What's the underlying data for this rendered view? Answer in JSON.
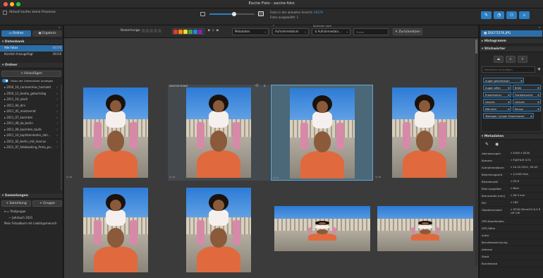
{
  "window": {
    "title": "Excire Foto - excire-foto"
  },
  "toolbar": {
    "status": "Aktuell laufen keine Prozesse",
    "zoom_value": 0.55,
    "count_line_prefix": "Fotos in der aktuellen Ansicht:",
    "count_value": "40378",
    "selected_line": "Fotos ausgewählt: 1"
  },
  "left": {
    "tabs": [
      "Ordner",
      "Ergebnis"
    ],
    "database_header": "Datenbank",
    "database_items": [
      {
        "label": "Alle Fotos",
        "count": "40378"
      },
      {
        "label": "Kürzlich hinzugefügt",
        "count": "39418"
      }
    ],
    "folders_header": "Ordner",
    "add_button": "+ Hinzufügen",
    "toggle_label": "Fotos der Unterordner anzeigen",
    "folders": [
      "2016_10_cannamirius_hochzeit",
      "2016_11_beatiu_geburtstag",
      "2011_10_ulach",
      "2011_04_dini",
      "2011_05_montserrat",
      "2011_07_kaernten",
      "2011_09_da_berlin",
      "2011_09_kaernten_taufe",
      "2011_10_kopfsteinhofen_dim...",
      "2012_02_berlin_mit_marcus",
      "2012_07_fotobooking_firma_pe..."
    ],
    "collections_header": "Sammlungen",
    "collection_button": "+ Sammlung",
    "group_button": "+ Gruppe",
    "collections": [
      "Testgruppe",
      "Jahrbuch 2021",
      "Mein Fotoalbum mit Lieblingsmensch"
    ]
  },
  "filter": {
    "rating_label": "Bewertung",
    "rating_value": "≥",
    "colors": [
      "#e53935",
      "#fb8c00",
      "#fdd835",
      "#43a047",
      "#1e88e5",
      "#8e24aa"
    ],
    "metadata_select": "Metadaten",
    "date_select": "Aufnahmedatum",
    "sort_label": "Sortieren nach",
    "sort_select": "Aufnahmedatu...",
    "search_placeholder": "Suche",
    "reset_button": "Zurücksetzen"
  },
  "grid": {
    "selected_label": "DSCF5576.RAF",
    "selected_index": 6
  },
  "right": {
    "file_name": "DSCF5576.JPG",
    "histogram_header": "Histogramm",
    "keywords_header": "Stichwörter",
    "keywords_placeholder": "Stichwörter hinzufügen",
    "keywords": [
      "Augen geschlossen",
      "Augen offen",
      "Brille",
      "Erwachsener",
      "Frontalansicht",
      "Gesicht",
      "Lächeln",
      "Männlich",
      "Person",
      "Teenager / junger Erwachsener"
    ],
    "metadata_header": "Metadaten",
    "metadata": [
      {
        "label": "Abmessungen",
        "value": "4160 x 6240"
      },
      {
        "label": "Kamera",
        "value": "FUJIFILM X-T4"
      },
      {
        "label": "Aufnahmedatum",
        "value": "24.10.2021, 09:43"
      },
      {
        "label": "Belichtungszeit",
        "value": "1/1000 Sek."
      },
      {
        "label": "Blendenzahl",
        "value": "f/5.6"
      },
      {
        "label": "Blitz ausgelöst",
        "value": "Nein"
      },
      {
        "label": "Brennweite (mm)",
        "value": "46.3 mm"
      },
      {
        "label": "ISO",
        "value": "160"
      },
      {
        "label": "Objektivmodell",
        "value": "XF18-55mmF2.8-4 R LM OIS"
      },
      {
        "label": "GPS-Koordinaten",
        "value": ""
      },
      {
        "label": "GPS-Höhe",
        "value": ""
      },
      {
        "label": "Autor",
        "value": ""
      },
      {
        "label": "Berufsbezeichnung",
        "value": ""
      },
      {
        "label": "Adresse",
        "value": ""
      },
      {
        "label": "Stadt",
        "value": ""
      },
      {
        "label": "Bundesland",
        "value": ""
      }
    ]
  }
}
